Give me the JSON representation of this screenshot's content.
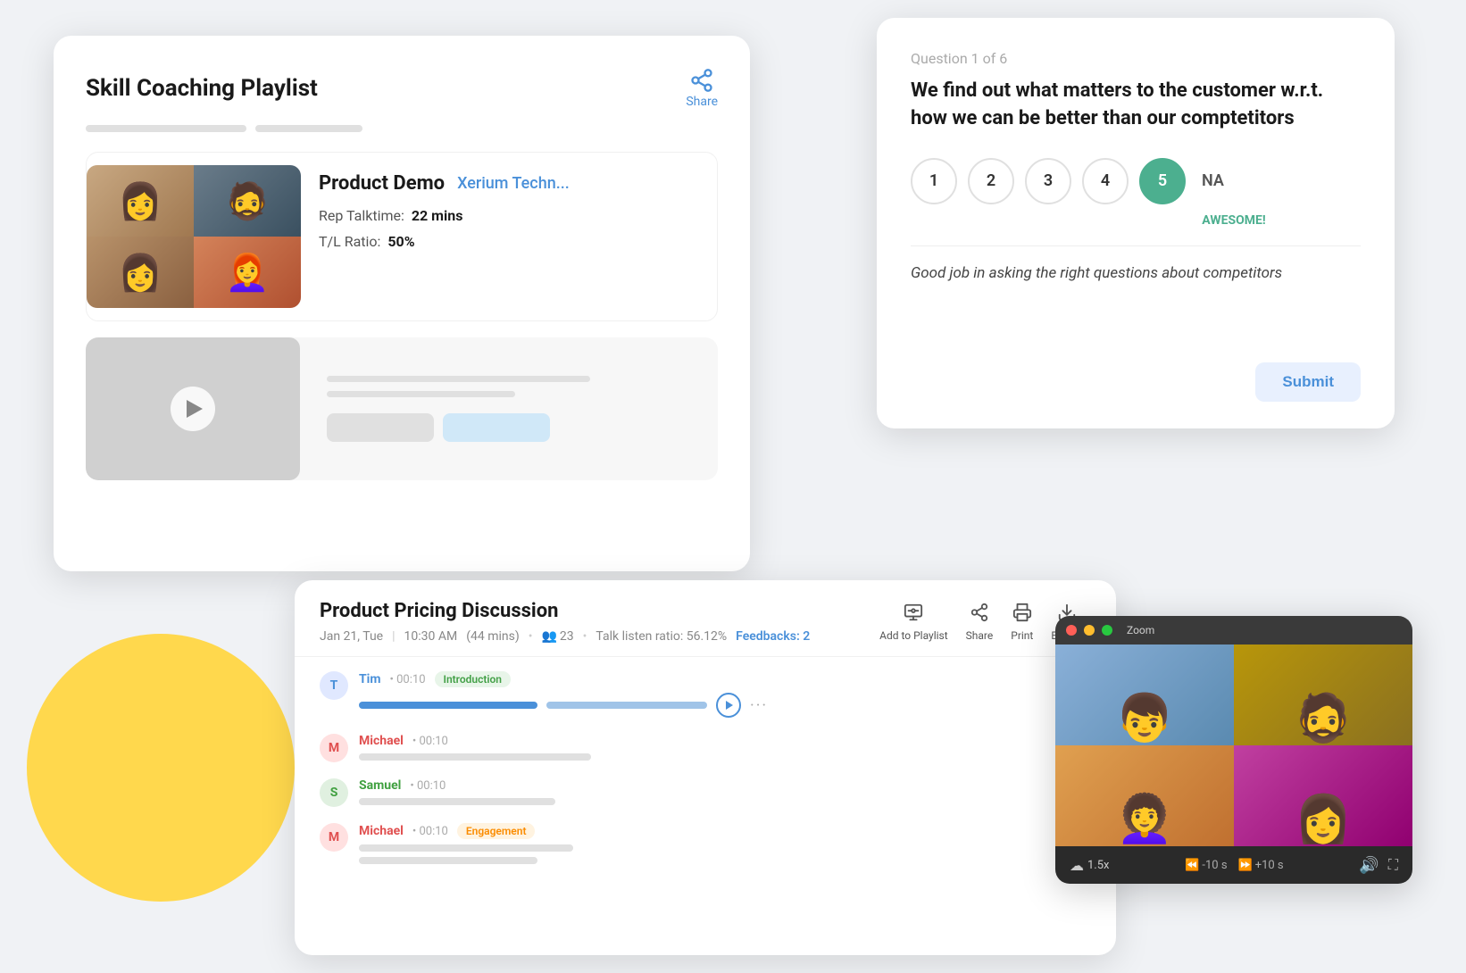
{
  "playlist": {
    "title": "Skill Coaching Playlist",
    "share_label": "Share",
    "call1": {
      "name": "Product Demo",
      "company": "Xerium Techn...",
      "rep_talktime_label": "Rep Talktime:",
      "rep_talktime_value": "22 mins",
      "tl_ratio_label": "T/L Ratio:",
      "tl_ratio_value": "50%"
    }
  },
  "question_card": {
    "label": "Question 1 of 6",
    "text": "We find out what matters to the customer w.r.t. how we can be better than our comptetitors",
    "ratings": [
      "1",
      "2",
      "3",
      "4",
      "5",
      "NA"
    ],
    "active_rating": "5",
    "awesome_label": "AWESOME!",
    "feedback": "Good job in asking the right questions about competitors",
    "submit_label": "Submit"
  },
  "call_detail": {
    "title": "Product Pricing Discussion",
    "date": "Jan 21, Tue",
    "time": "10:30 AM",
    "duration": "44 mins",
    "participants": "23",
    "talk_listen_ratio": "Talk listen ratio: 56.12%",
    "feedbacks_label": "Feedbacks: 2",
    "actions": {
      "add_to_playlist": "Add to Playlist",
      "share": "Share",
      "print": "Print",
      "export": "Export"
    },
    "transcript": [
      {
        "speaker": "Tim",
        "time": "00:10",
        "tag": "Introduction",
        "tag_type": "intro",
        "initial": "T",
        "has_audio": true
      },
      {
        "speaker": "Michael",
        "time": "00:10",
        "tag": null,
        "initial": "M",
        "has_audio": false
      },
      {
        "speaker": "Samuel",
        "time": "00:10",
        "tag": null,
        "initial": "S",
        "has_audio": false
      },
      {
        "speaker": "Michael",
        "time": "00:10",
        "tag": "Engagement",
        "tag_type": "engagement",
        "initial": "M",
        "has_audio": false
      }
    ]
  },
  "video": {
    "zoom_title": "Zoom",
    "speed": "1.5x",
    "rewind_label": "-10 s",
    "forward_label": "+10 s"
  }
}
